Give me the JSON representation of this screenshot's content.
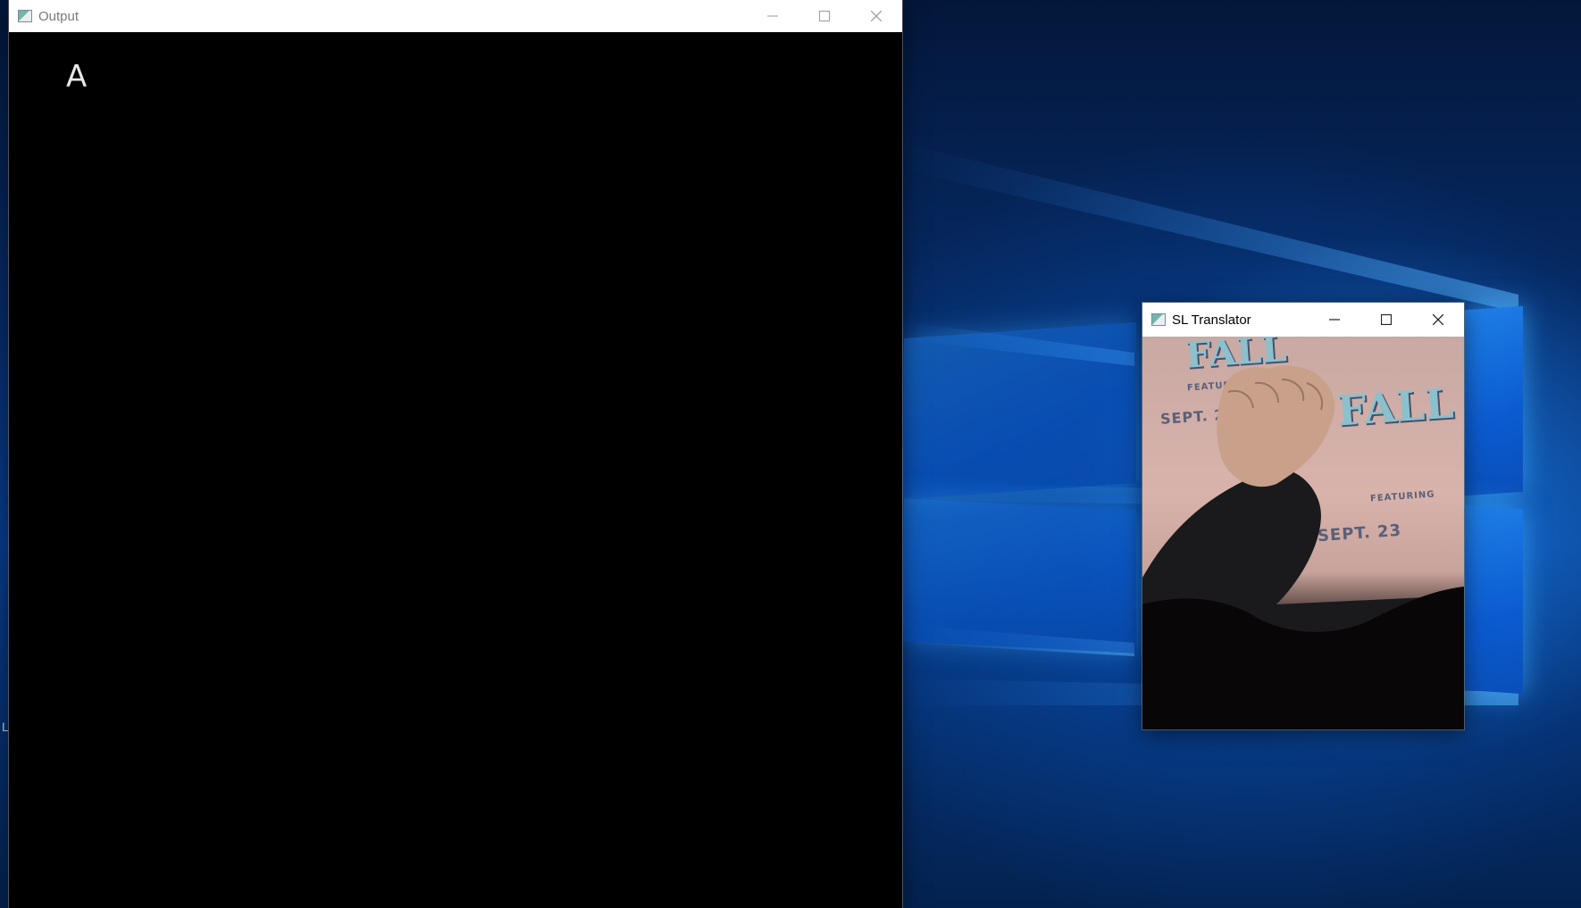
{
  "desktop": {
    "edge_text": "L"
  },
  "output_window": {
    "title": "Output",
    "minimize_label": "minimize",
    "maximize_label": "maximize",
    "close_label": "close",
    "recognized_letter": "A"
  },
  "translator_window": {
    "title": "SL Translator",
    "feed": {
      "poster_lines": [
        "SEPT. 23",
        "FEATURING",
        "SEPT. 23",
        "FEATURING"
      ],
      "poster_titles": [
        "FALL",
        "FALL"
      ]
    }
  },
  "colors": {
    "accent": "#1e90ff",
    "titlebar": "#ffffff",
    "window_bg": "#000000"
  }
}
